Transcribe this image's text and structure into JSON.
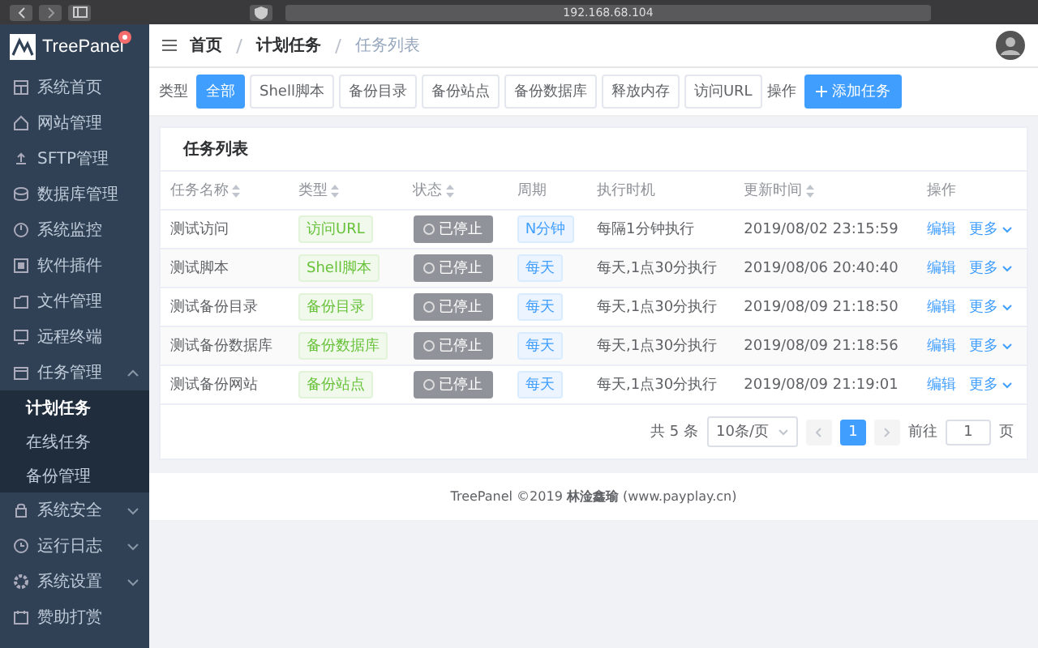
{
  "browser": {
    "address": "192.168.68.104"
  },
  "brand": {
    "name": "TreePanel"
  },
  "sidebar": {
    "items": [
      {
        "label": "系统首页",
        "kind": "link"
      },
      {
        "label": "网站管理",
        "kind": "link"
      },
      {
        "label": "SFTP管理",
        "kind": "link"
      },
      {
        "label": "数据库管理",
        "kind": "link"
      },
      {
        "label": "系统监控",
        "kind": "link"
      },
      {
        "label": "软件插件",
        "kind": "link"
      },
      {
        "label": "文件管理",
        "kind": "link"
      },
      {
        "label": "远程终端",
        "kind": "link"
      },
      {
        "label": "任务管理",
        "kind": "group",
        "expanded": true,
        "children": [
          {
            "label": "计划任务",
            "selected": true
          },
          {
            "label": "在线任务",
            "selected": false
          },
          {
            "label": "备份管理",
            "selected": false
          }
        ]
      },
      {
        "label": "系统安全",
        "kind": "group",
        "expanded": false
      },
      {
        "label": "运行日志",
        "kind": "group",
        "expanded": false
      },
      {
        "label": "系统设置",
        "kind": "group",
        "expanded": false
      },
      {
        "label": "赞助打赏",
        "kind": "link"
      }
    ]
  },
  "breadcrumb": [
    {
      "label": "首页",
      "current": false
    },
    {
      "label": "计划任务",
      "current": false
    },
    {
      "label": "任务列表",
      "current": true
    }
  ],
  "filters": {
    "label": "类型",
    "options": [
      {
        "label": "全部",
        "selected": true
      },
      {
        "label": "Shell脚本",
        "selected": false
      },
      {
        "label": "备份目录",
        "selected": false
      },
      {
        "label": "备份站点",
        "selected": false
      },
      {
        "label": "备份数据库",
        "selected": false
      },
      {
        "label": "释放内存",
        "selected": false
      },
      {
        "label": "访问URL",
        "selected": false
      }
    ],
    "actions_label": "操作",
    "add_button": "添加任务"
  },
  "card": {
    "title": "任务列表"
  },
  "table": {
    "columns": [
      {
        "label": "任务名称",
        "sortable": true
      },
      {
        "label": "类型",
        "sortable": true
      },
      {
        "label": "状态",
        "sortable": true
      },
      {
        "label": "周期",
        "sortable": false
      },
      {
        "label": "执行时机",
        "sortable": false
      },
      {
        "label": "更新时间",
        "sortable": true
      },
      {
        "label": "操作",
        "sortable": false
      }
    ],
    "rows": [
      {
        "name": "测试访问",
        "type": "访问URL",
        "status": "已停止",
        "cycle": "N分钟",
        "timing": "每隔1分钟执行",
        "updated": "2019/08/02 23:15:59",
        "edit": "编辑",
        "more": "更多"
      },
      {
        "name": "测试脚本",
        "type": "Shell脚本",
        "status": "已停止",
        "cycle": "每天",
        "timing": "每天,1点30分执行",
        "updated": "2019/08/06 20:40:40",
        "edit": "编辑",
        "more": "更多"
      },
      {
        "name": "测试备份目录",
        "type": "备份目录",
        "status": "已停止",
        "cycle": "每天",
        "timing": "每天,1点30分执行",
        "updated": "2019/08/09 21:18:50",
        "edit": "编辑",
        "more": "更多"
      },
      {
        "name": "测试备份数据库",
        "type": "备份数据库",
        "status": "已停止",
        "cycle": "每天",
        "timing": "每天,1点30分执行",
        "updated": "2019/08/09 21:18:56",
        "edit": "编辑",
        "more": "更多"
      },
      {
        "name": "测试备份网站",
        "type": "备份站点",
        "status": "已停止",
        "cycle": "每天",
        "timing": "每天,1点30分执行",
        "updated": "2019/08/09 21:19:01",
        "edit": "编辑",
        "more": "更多"
      }
    ]
  },
  "pagination": {
    "total": "共 5 条",
    "page_size": "10条/页",
    "pages": [
      {
        "label": "1",
        "selected": true
      }
    ],
    "goto_label": "前往",
    "goto_value": "1",
    "goto_suffix": "页"
  },
  "footer": "TreePanel ©2019 **林淦鑫瑜** (www.payplay.cn)"
}
